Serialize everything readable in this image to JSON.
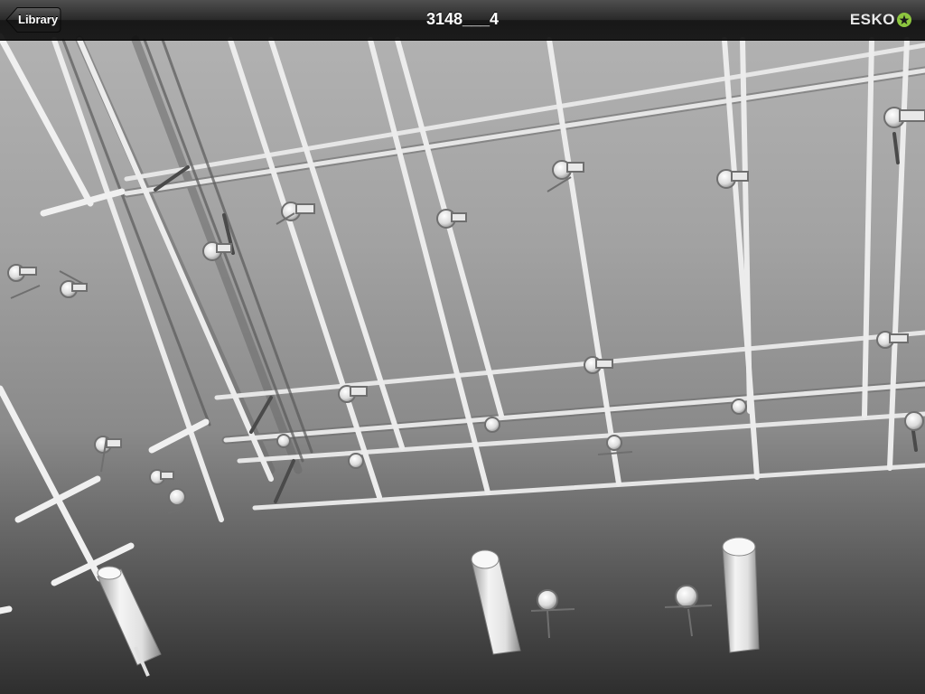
{
  "navbar": {
    "back_label": "Library",
    "title": "3148___4",
    "brand_text": "ESKO",
    "brand_mark_icon": "esko-star-icon"
  },
  "viewport": {
    "content": "3d-model-view"
  },
  "colors": {
    "navbar_bg": "#1a1a1a",
    "navbar_text": "#ffffff",
    "brand_accent": "#8dc63f",
    "model_surface": "#f2f2f2",
    "background_top": "#b4b4b4",
    "background_bottom": "#2e2e2e"
  }
}
